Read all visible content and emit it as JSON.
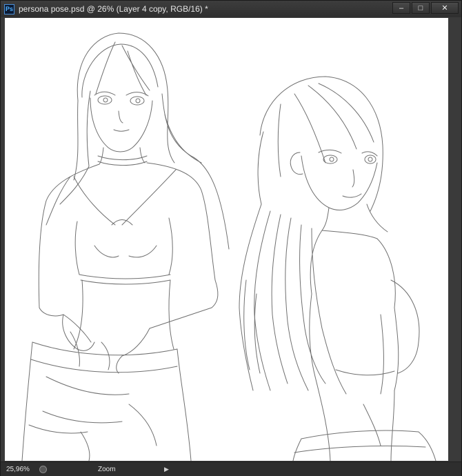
{
  "window": {
    "app_icon_label": "Ps",
    "title": "persona pose.psd @ 26% (Layer 4 copy, RGB/16) *",
    "buttons": {
      "minimize": "–",
      "maximize": "□",
      "close": "✕"
    }
  },
  "canvas": {
    "content": "pencil-sketch",
    "background": "#ffffff",
    "stroke_color": "#6f6f6f"
  },
  "statusbar": {
    "zoom": "25,96%",
    "info": "Zoom",
    "arrow": "▶"
  }
}
